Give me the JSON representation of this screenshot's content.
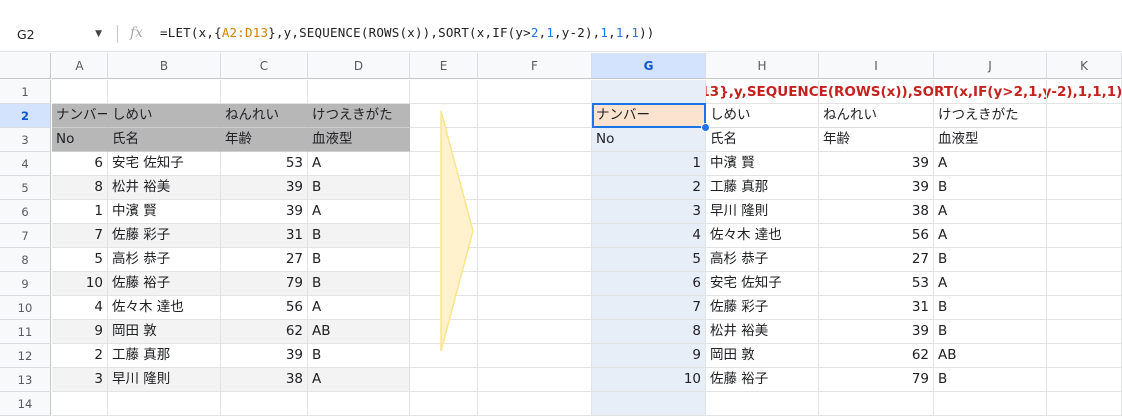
{
  "formula_bar": {
    "cell_ref": "G2",
    "fx_label": "fx",
    "formula_parts": [
      {
        "t": "=LET(x,{",
        "c": ""
      },
      {
        "t": "A2:D13",
        "c": "ref"
      },
      {
        "t": "},y,SEQUENCE(ROWS(x)),SORT(x,IF(y>",
        "c": ""
      },
      {
        "t": "2",
        "c": "num"
      },
      {
        "t": ",",
        "c": ""
      },
      {
        "t": "1",
        "c": "num"
      },
      {
        "t": ",y-2),",
        "c": ""
      },
      {
        "t": "1",
        "c": "num"
      },
      {
        "t": ",",
        "c": ""
      },
      {
        "t": "1",
        "c": "num"
      },
      {
        "t": ",",
        "c": ""
      },
      {
        "t": "1",
        "c": "num"
      },
      {
        "t": "))",
        "c": ""
      }
    ]
  },
  "columns": [
    "A",
    "B",
    "C",
    "D",
    "E",
    "F",
    "G",
    "H",
    "I",
    "J",
    "K"
  ],
  "rows": [
    "1",
    "2",
    "3",
    "4",
    "5",
    "6",
    "7",
    "8",
    "9",
    "10",
    "11",
    "12",
    "13",
    "14"
  ],
  "selected_col": "G",
  "selected_row": "2",
  "source": {
    "header_kana": [
      "ナンバー",
      "しめい",
      "ねんれい",
      "けつえきがた"
    ],
    "header": [
      "No",
      "氏名",
      "年齢",
      "血液型"
    ],
    "rows": [
      [
        "6",
        "安宅 佐知子",
        "53",
        "A"
      ],
      [
        "8",
        "松井 裕美",
        "39",
        "B"
      ],
      [
        "1",
        "中濱 賢",
        "39",
        "A"
      ],
      [
        "7",
        "佐藤 彩子",
        "31",
        "B"
      ],
      [
        "5",
        "高杉 恭子",
        "27",
        "B"
      ],
      [
        "10",
        "佐藤 裕子",
        "79",
        "B"
      ],
      [
        "4",
        "佐々木 達也",
        "56",
        "A"
      ],
      [
        "9",
        "岡田 敦",
        "62",
        "AB"
      ],
      [
        "2",
        "工藤 真那",
        "39",
        "B"
      ],
      [
        "3",
        "早川 隆則",
        "38",
        "A"
      ]
    ]
  },
  "result": {
    "formula_display": "=LET(x,{A2:D13},y,SEQUENCE(ROWS(x)),SORT(x,IF(y>2,1,y-2),1,1,1))",
    "header_kana": [
      "ナンバー",
      "しめい",
      "ねんれい",
      "けつえきがた"
    ],
    "header": [
      "No",
      "氏名",
      "年齢",
      "血液型"
    ],
    "rows": [
      [
        "1",
        "中濱 賢",
        "39",
        "A"
      ],
      [
        "2",
        "工藤 真那",
        "39",
        "B"
      ],
      [
        "3",
        "早川 隆則",
        "38",
        "A"
      ],
      [
        "4",
        "佐々木 達也",
        "56",
        "A"
      ],
      [
        "5",
        "高杉 恭子",
        "27",
        "B"
      ],
      [
        "6",
        "安宅 佐知子",
        "53",
        "A"
      ],
      [
        "7",
        "佐藤 彩子",
        "31",
        "B"
      ],
      [
        "8",
        "松井 裕美",
        "39",
        "B"
      ],
      [
        "9",
        "岡田 敦",
        "62",
        "AB"
      ],
      [
        "10",
        "佐藤 裕子",
        "79",
        "B"
      ]
    ]
  },
  "colors": {
    "header_fill": "#b7b7b7",
    "stripe_fill": "#f3f3f3",
    "selection_fill": "#fbe3cf",
    "formula_text": "#c5221f",
    "selection_border": "#1a73e8",
    "arrow_fill": "#fff2cc"
  }
}
